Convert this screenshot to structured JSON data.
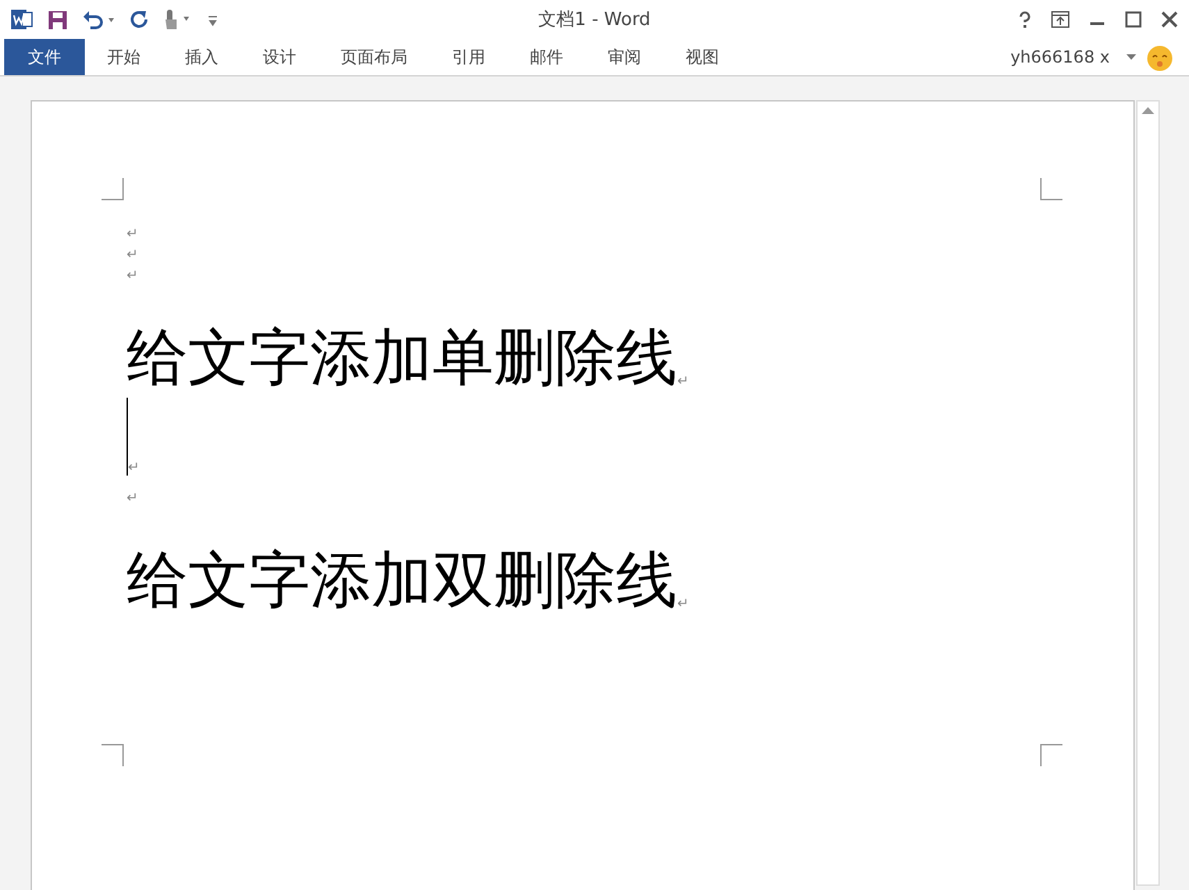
{
  "window": {
    "title": "文档1 - Word"
  },
  "ribbon_tabs": [
    {
      "label": "文件",
      "selected": true
    },
    {
      "label": "开始",
      "selected": false
    },
    {
      "label": "插入",
      "selected": false
    },
    {
      "label": "设计",
      "selected": false
    },
    {
      "label": "页面布局",
      "selected": false
    },
    {
      "label": "引用",
      "selected": false
    },
    {
      "label": "邮件",
      "selected": false
    },
    {
      "label": "审阅",
      "selected": false
    },
    {
      "label": "视图",
      "selected": false
    }
  ],
  "account": {
    "user": "yh666168 x"
  },
  "document": {
    "paragraphs": [
      {
        "kind": "small",
        "mark": "↵"
      },
      {
        "kind": "small",
        "mark": "↵"
      },
      {
        "kind": "small",
        "mark": "↵"
      },
      {
        "kind": "large",
        "text": "给文字添加单删除线",
        "mark": "↵"
      },
      {
        "kind": "cursor",
        "mark": "↵"
      },
      {
        "kind": "normal",
        "mark": "↵"
      },
      {
        "kind": "large",
        "text": "给文字添加双删除线",
        "mark": "↵"
      }
    ]
  }
}
